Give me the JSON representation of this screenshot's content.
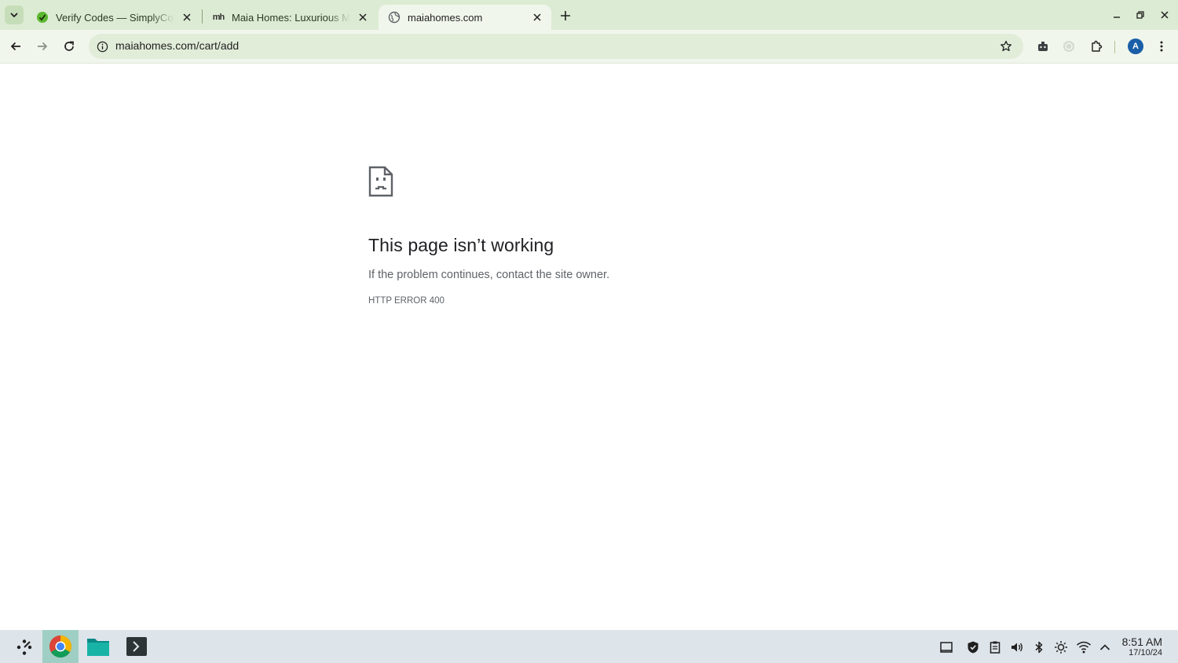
{
  "browser": {
    "tabs": [
      {
        "title": "Verify Codes — SimplyCodes",
        "favicon": "simplycodes-icon",
        "active": false
      },
      {
        "title": "Maia Homes: Luxurious Maia",
        "favicon": "maia-homes-icon",
        "favicon_text": "mh",
        "active": false
      },
      {
        "title": "maiahomes.com",
        "favicon": "globe-icon",
        "active": true
      }
    ],
    "url": "maiahomes.com/cart/add",
    "profile_initial": "A"
  },
  "error": {
    "title": "This page isn’t working",
    "description": "If the problem continues, contact the site owner.",
    "code": "HTTP ERROR 400"
  },
  "taskbar": {
    "apps": [
      "chrome-icon",
      "files-icon",
      "terminal-icon"
    ],
    "time": "8:51 AM",
    "date": "17/10/24"
  },
  "colors": {
    "tabstrip_bg": "#dcebd3",
    "toolbar_bg": "#f1f6ec",
    "omnibox_bg": "#e1ecd9",
    "taskbar_bg": "#dde4ea",
    "active_app_bg": "#9fcfc4",
    "avatar_bg": "#1a5ea8"
  }
}
